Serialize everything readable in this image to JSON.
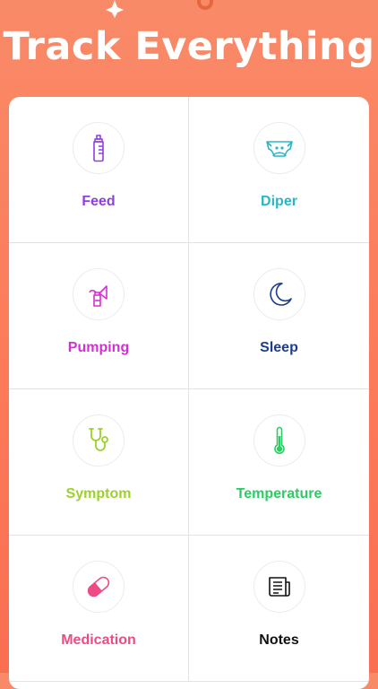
{
  "headline": "Track Everything",
  "colors": {
    "background": "#FC7A5A",
    "card": "#FFFFFF",
    "divider": "#E3E3E6"
  },
  "trackers": [
    {
      "label": "Feed",
      "icon": "baby-bottle-icon",
      "color": "#8E3FE0"
    },
    {
      "label": "Diper",
      "icon": "diaper-icon",
      "color": "#2BB5C9"
    },
    {
      "label": "Pumping",
      "icon": "breast-pump-icon",
      "color": "#D42FD6"
    },
    {
      "label": "Sleep",
      "icon": "moon-icon",
      "color": "#1D3E8C"
    },
    {
      "label": "Symptom",
      "icon": "stethoscope-icon",
      "color": "#9DD12A"
    },
    {
      "label": "Temperature",
      "icon": "thermometer-icon",
      "color": "#2BCC64"
    },
    {
      "label": "Medication",
      "icon": "pill-icon",
      "color": "#EE4B86"
    },
    {
      "label": "Notes",
      "icon": "notes-icon",
      "color": "#111111"
    }
  ]
}
